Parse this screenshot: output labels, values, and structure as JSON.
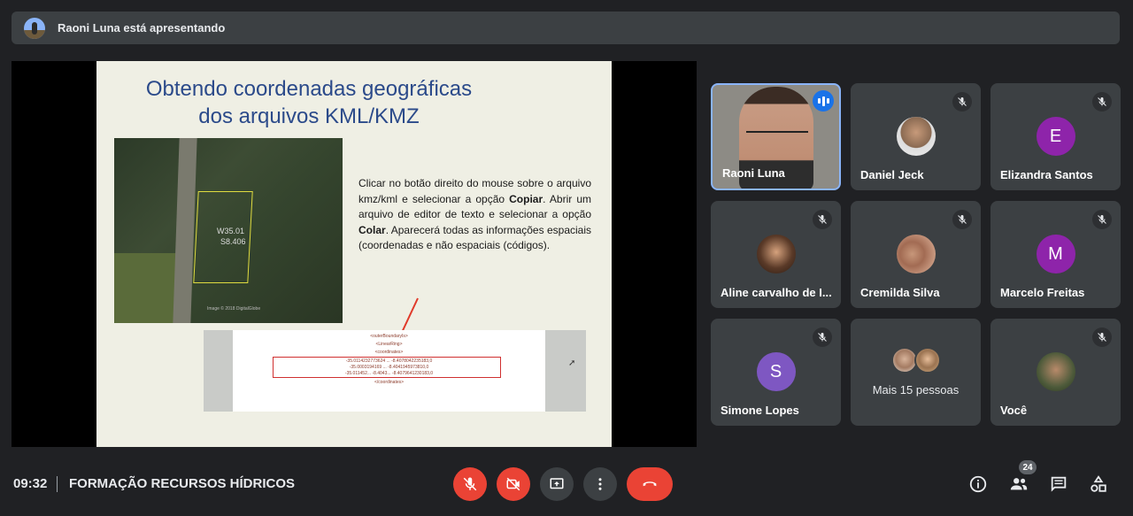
{
  "banner": {
    "text": "Raoni Luna está apresentando"
  },
  "slide": {
    "title_line1": "Obtendo coordenadas geográficas",
    "title_line2": "dos arquivos KML/KMZ",
    "image_label_1": "W35.01",
    "image_label_2": "S8.406",
    "image_credit": "Image © 2018 DigitalGlobe",
    "body_part1": "Clicar no botão direito do mouse sobre o arquivo kmz/kml e selecionar a opção ",
    "body_bold1": "Copiar",
    "body_part2": ". Abrir um arquivo de editor de texto e selecionar a opção ",
    "body_bold2": "Colar",
    "body_part3": ". Aparecerá todas as informações espaciais (coordenadas e não espaciais (códigos).",
    "code_lines": [
      "<outerBoundaryIs>",
      "<LinearRing>",
      "<coordinates>",
      "-35.0114232773624 ... -8.4078042235183,0",
      "-35.0003194169 ... -8.4041945973810,0",
      "-35.011452... -8.4043... -8.4079641230183,0",
      "</coordinates>"
    ]
  },
  "participants": [
    {
      "name": "Raoni Luna",
      "active": true
    },
    {
      "name": "Daniel Jeck",
      "muted": true
    },
    {
      "name": "Elizandra Santos",
      "initial": "E",
      "color": "#8e24aa",
      "muted": true
    },
    {
      "name": "Aline carvalho de I...",
      "muted": true
    },
    {
      "name": "Cremilda Silva",
      "muted": true
    },
    {
      "name": "Marcelo Freitas",
      "initial": "M",
      "color": "#8e24aa",
      "muted": true
    },
    {
      "name": "Simone Lopes",
      "initial": "S",
      "color": "#7e57c2",
      "muted": true
    },
    {
      "more_label": "Mais 15 pessoas"
    },
    {
      "name": "Você",
      "muted": true
    }
  ],
  "bottom_bar": {
    "time": "09:32",
    "separator": "|",
    "meeting_title": "FORMAÇÃO RECURSOS HÍDRICOS",
    "participant_count": "24"
  },
  "colors": {
    "accent": "#8ab4f8",
    "danger": "#ea4335",
    "surface": "#3c4043",
    "background": "#202124"
  }
}
